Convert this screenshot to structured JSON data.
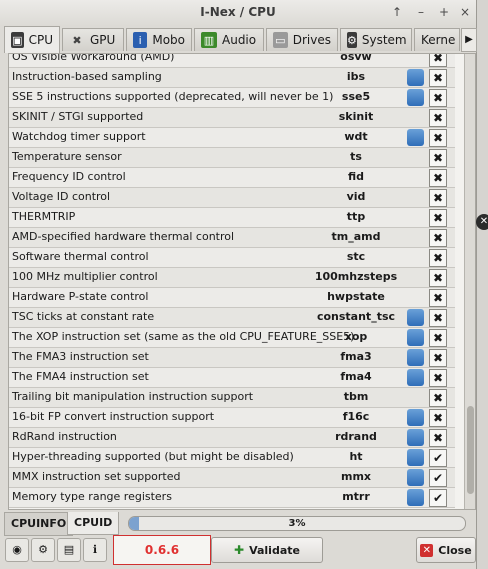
{
  "window": {
    "title": "I-Nex / CPU"
  },
  "tabs": [
    {
      "label": "CPU",
      "icon": "cpu-icon"
    },
    {
      "label": "GPU",
      "icon": "gpu-icon"
    },
    {
      "label": "Mobo",
      "icon": "mobo-icon"
    },
    {
      "label": "Audio",
      "icon": "audio-icon"
    },
    {
      "label": "Drives",
      "icon": "drives-icon"
    },
    {
      "label": "System",
      "icon": "system-icon"
    },
    {
      "label": "Kerne",
      "icon": "kernel-icon"
    }
  ],
  "flags": [
    {
      "desc": "OS Visible Workaround (AMD)",
      "flag": "osvw",
      "badge": false,
      "state": "x"
    },
    {
      "desc": "Instruction-based sampling",
      "flag": "ibs",
      "badge": true,
      "state": "x"
    },
    {
      "desc": "SSE 5 instructions supported (deprecated, will never be 1)",
      "flag": "sse5",
      "badge": true,
      "state": "x"
    },
    {
      "desc": "SKINIT / STGI supported",
      "flag": "skinit",
      "badge": false,
      "state": "x"
    },
    {
      "desc": "Watchdog timer support",
      "flag": "wdt",
      "badge": true,
      "state": "x"
    },
    {
      "desc": "Temperature sensor",
      "flag": "ts",
      "badge": false,
      "state": "x"
    },
    {
      "desc": "Frequency ID control",
      "flag": "fid",
      "badge": false,
      "state": "x"
    },
    {
      "desc": "Voltage ID control",
      "flag": "vid",
      "badge": false,
      "state": "x"
    },
    {
      "desc": "THERMTRIP",
      "flag": "ttp",
      "badge": false,
      "state": "x"
    },
    {
      "desc": "AMD-specified hardware thermal control",
      "flag": "tm_amd",
      "badge": false,
      "state": "x"
    },
    {
      "desc": "Software thermal control",
      "flag": "stc",
      "badge": false,
      "state": "x"
    },
    {
      "desc": "100 MHz multiplier control",
      "flag": "100mhzsteps",
      "badge": false,
      "state": "x"
    },
    {
      "desc": "Hardware P-state control",
      "flag": "hwpstate",
      "badge": false,
      "state": "x"
    },
    {
      "desc": "TSC ticks at constant rate",
      "flag": "constant_tsc",
      "badge": true,
      "state": "x"
    },
    {
      "desc": "The XOP instruction set (same as the old CPU_FEATURE_SSE5)",
      "flag": "xop",
      "badge": true,
      "state": "x"
    },
    {
      "desc": "The FMA3 instruction set",
      "flag": "fma3",
      "badge": true,
      "state": "x"
    },
    {
      "desc": "The FMA4 instruction set",
      "flag": "fma4",
      "badge": true,
      "state": "x"
    },
    {
      "desc": "Trailing bit manipulation instruction support",
      "flag": "tbm",
      "badge": false,
      "state": "x"
    },
    {
      "desc": "16-bit FP convert instruction support",
      "flag": "f16c",
      "badge": true,
      "state": "x"
    },
    {
      "desc": "RdRand instruction",
      "flag": "rdrand",
      "badge": true,
      "state": "x"
    },
    {
      "desc": "Hyper-threading supported (but might be disabled)",
      "flag": "ht",
      "badge": true,
      "state": "check"
    },
    {
      "desc": "MMX instruction set supported",
      "flag": "mmx",
      "badge": true,
      "state": "check"
    },
    {
      "desc": "Memory type range registers",
      "flag": "mtrr",
      "badge": true,
      "state": "check"
    }
  ],
  "bottom_tabs": {
    "left": "CPUINFO",
    "right": "CPUID"
  },
  "progress": {
    "percent": 3,
    "label": "3%"
  },
  "footer": {
    "version": "0.6.6",
    "validate_label": "Validate",
    "close_label": "Close"
  },
  "colors": {
    "badge_blue": "#3b7bc4",
    "version_red": "#e03030"
  }
}
